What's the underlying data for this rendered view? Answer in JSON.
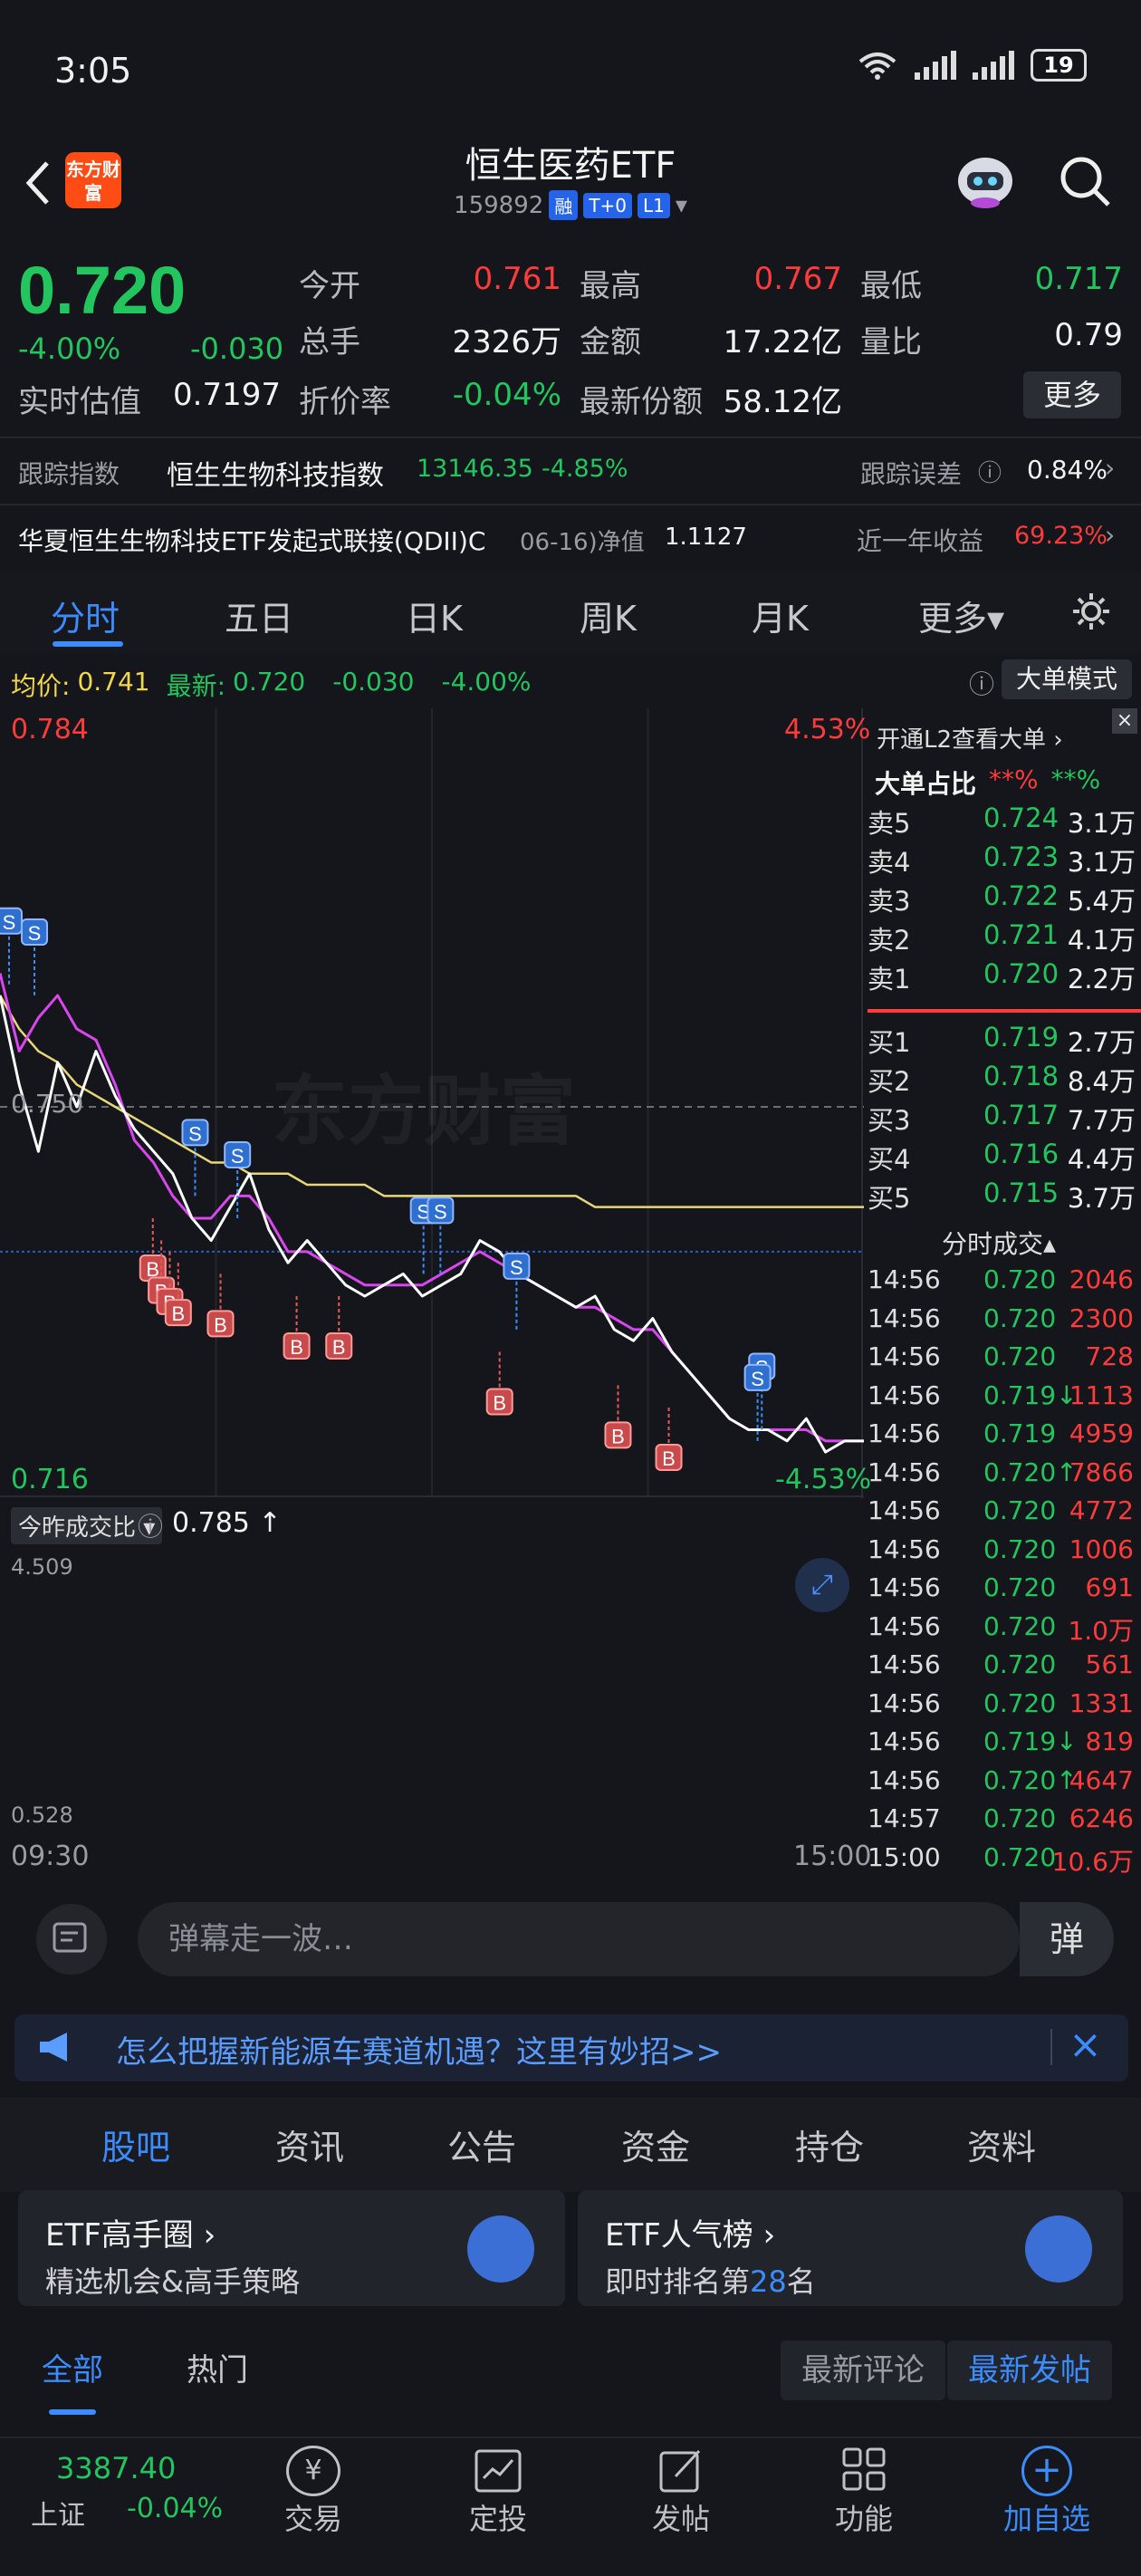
{
  "status_bar": {
    "time": "3:05",
    "battery": "19"
  },
  "header": {
    "logo_text": "东方财富",
    "title": "恒生医药ETF",
    "code": "159892",
    "tags": [
      "融",
      "T+0",
      "L1"
    ]
  },
  "quote": {
    "price": "0.720",
    "change_pct": "-4.00%",
    "change": "-0.030",
    "fields": [
      {
        "label": "今开",
        "value": "0.761",
        "color": "#ff3b3b"
      },
      {
        "label": "最高",
        "value": "0.767",
        "color": "#ff3b3b"
      },
      {
        "label": "最低",
        "value": "0.717",
        "color": "#22c55e"
      },
      {
        "label": "总手",
        "value": "2326万",
        "color": "#f2f2f2"
      },
      {
        "label": "金额",
        "value": "17.22亿",
        "color": "#f2f2f2"
      },
      {
        "label": "量比",
        "value": "0.79",
        "color": "#f2f2f2"
      },
      {
        "label": "实时估值",
        "value": "0.7197",
        "color": "#f2f2f2"
      },
      {
        "label": "折价率",
        "value": "-0.04%",
        "color": "#22c55e"
      },
      {
        "label": "最新份额",
        "value": "58.12亿",
        "color": "#f2f2f2"
      }
    ],
    "more_label": "更多"
  },
  "tracking": {
    "label": "跟踪指数",
    "index_name": "恒生生物科技指数",
    "index_value": "13146.35",
    "index_pct": "-4.85%",
    "error_label": "跟踪误差",
    "error_value": "0.84%"
  },
  "fund_link": {
    "name": "华夏恒生生物科技ETF发起式联接(QDII)C",
    "date_label": "06-16)净值",
    "nav": "1.1127",
    "yield_label": "近一年收益",
    "yield_value": "69.23%"
  },
  "tabs": [
    "分时",
    "五日",
    "日K",
    "周K",
    "月K",
    "更多▾"
  ],
  "chart_info": {
    "avg_label": "均价:",
    "avg_value": "0.741",
    "last_label": "最新:",
    "last_value": "0.720",
    "chg": "-0.030",
    "pct": "-4.00%",
    "mode_button": "大单模式"
  },
  "chart_data": {
    "type": "line",
    "title": "",
    "ylim": [
      0.716,
      0.784
    ],
    "y_max_label": "0.784",
    "y_mid_label": "0.750",
    "y_min_label": "0.716",
    "pct_max_label": "4.53%",
    "pct_min_label": "-4.53%",
    "x_start": "09:30",
    "x_end": "15:00",
    "watermark": "东方财富",
    "series": [
      {
        "values": [
          0.76,
          0.752,
          0.746,
          0.754,
          0.75,
          0.755,
          0.751,
          0.748,
          0.746,
          0.744,
          0.74,
          0.738,
          0.741,
          0.744,
          0.739,
          0.736,
          0.738,
          0.736,
          0.734,
          0.733,
          0.734,
          0.735,
          0.733,
          0.734,
          0.735,
          0.738,
          0.737,
          0.735,
          0.734,
          0.733,
          0.732,
          0.733,
          0.73,
          0.729,
          0.731,
          0.728,
          0.726,
          0.724,
          0.722,
          0.721,
          0.721,
          0.72,
          0.722,
          0.719,
          0.72,
          0.72
        ],
        "color": "#ffffff"
      },
      {
        "values": [
          0.762,
          0.755,
          0.758,
          0.76,
          0.757,
          0.756,
          0.752,
          0.747,
          0.745,
          0.742,
          0.74,
          0.74,
          0.742,
          0.742,
          0.74,
          0.737,
          0.737,
          0.736,
          0.735,
          0.734,
          0.734,
          0.734,
          0.734,
          0.735,
          0.736,
          0.737,
          0.736,
          0.735,
          0.734,
          0.733,
          0.732,
          0.732,
          0.731,
          0.73,
          0.73,
          0.728,
          0.726,
          0.724,
          0.722,
          0.721,
          0.721,
          0.721,
          0.721,
          0.72,
          0.72,
          0.72
        ],
        "color": "#d946ef"
      },
      {
        "values": [
          0.76,
          0.757,
          0.755,
          0.754,
          0.752,
          0.751,
          0.75,
          0.749,
          0.748,
          0.747,
          0.746,
          0.745,
          0.745,
          0.744,
          0.744,
          0.744,
          0.743,
          0.743,
          0.743,
          0.743,
          0.742,
          0.742,
          0.742,
          0.742,
          0.742,
          0.742,
          0.742,
          0.742,
          0.742,
          0.742,
          0.742,
          0.741,
          0.741,
          0.741,
          0.741,
          0.741,
          0.741,
          0.741,
          0.741,
          0.741,
          0.741,
          0.741,
          0.741,
          0.741,
          0.741,
          0.741
        ],
        "color": "#e8d77a"
      }
    ],
    "markers": [
      {
        "label": "S",
        "x": 0.0,
        "y": 0.761
      },
      {
        "label": "S",
        "x": 0.03,
        "y": 0.76
      },
      {
        "label": "S",
        "x": 0.22,
        "y": 0.742
      },
      {
        "label": "S",
        "x": 0.27,
        "y": 0.74
      },
      {
        "label": "S",
        "x": 0.49,
        "y": 0.735
      },
      {
        "label": "S",
        "x": 0.51,
        "y": 0.735
      },
      {
        "label": "S",
        "x": 0.6,
        "y": 0.73
      },
      {
        "label": "S",
        "x": 0.89,
        "y": 0.721
      },
      {
        "label": "S",
        "x": 0.885,
        "y": 0.72
      },
      {
        "label": "B",
        "x": 0.17,
        "y": 0.74
      },
      {
        "label": "B",
        "x": 0.18,
        "y": 0.738
      },
      {
        "label": "B",
        "x": 0.19,
        "y": 0.737
      },
      {
        "label": "B",
        "x": 0.2,
        "y": 0.736
      },
      {
        "label": "B",
        "x": 0.25,
        "y": 0.735
      },
      {
        "label": "B",
        "x": 0.34,
        "y": 0.733
      },
      {
        "label": "B",
        "x": 0.39,
        "y": 0.733
      },
      {
        "label": "B",
        "x": 0.58,
        "y": 0.728
      },
      {
        "label": "B",
        "x": 0.72,
        "y": 0.725
      },
      {
        "label": "B",
        "x": 0.78,
        "y": 0.723
      }
    ]
  },
  "volume_panel": {
    "selector": "今昨成交比",
    "ratio": "0.785",
    "top_label": "4.509",
    "bottom_label": "0.528"
  },
  "orderbook": {
    "open_l2": "开通L2查看大单",
    "big_ratio_label": "大单占比",
    "big_ratio_red": "**%",
    "big_ratio_green": "**%",
    "asks": [
      {
        "label": "卖5",
        "price": "0.724",
        "vol": "3.1万"
      },
      {
        "label": "卖4",
        "price": "0.723",
        "vol": "3.1万"
      },
      {
        "label": "卖3",
        "price": "0.722",
        "vol": "5.4万"
      },
      {
        "label": "卖2",
        "price": "0.721",
        "vol": "4.1万"
      },
      {
        "label": "卖1",
        "price": "0.720",
        "vol": "2.2万"
      }
    ],
    "bids": [
      {
        "label": "买1",
        "price": "0.719",
        "vol": "2.7万"
      },
      {
        "label": "买2",
        "price": "0.718",
        "vol": "8.4万"
      },
      {
        "label": "买3",
        "price": "0.717",
        "vol": "7.7万"
      },
      {
        "label": "买4",
        "price": "0.716",
        "vol": "4.4万"
      },
      {
        "label": "买5",
        "price": "0.715",
        "vol": "3.7万"
      }
    ],
    "trades_title": "分时成交▴",
    "trades": [
      {
        "t": "14:56",
        "p": "0.720",
        "v": "2046",
        "arrow": ""
      },
      {
        "t": "14:56",
        "p": "0.720",
        "v": "2300",
        "arrow": ""
      },
      {
        "t": "14:56",
        "p": "0.720",
        "v": "728",
        "arrow": ""
      },
      {
        "t": "14:56",
        "p": "0.719↓",
        "v": "1113",
        "arrow": "down"
      },
      {
        "t": "14:56",
        "p": "0.719",
        "v": "4959",
        "arrow": "down"
      },
      {
        "t": "14:56",
        "p": "0.720↑",
        "v": "7866",
        "arrow": "up"
      },
      {
        "t": "14:56",
        "p": "0.720",
        "v": "4772",
        "arrow": ""
      },
      {
        "t": "14:56",
        "p": "0.720",
        "v": "1006",
        "arrow": ""
      },
      {
        "t": "14:56",
        "p": "0.720",
        "v": "691",
        "arrow": ""
      },
      {
        "t": "14:56",
        "p": "0.720",
        "v": "1.0万",
        "arrow": ""
      },
      {
        "t": "14:56",
        "p": "0.720",
        "v": "561",
        "arrow": ""
      },
      {
        "t": "14:56",
        "p": "0.720",
        "v": "1331",
        "arrow": ""
      },
      {
        "t": "14:56",
        "p": "0.719↓",
        "v": "819",
        "arrow": "down"
      },
      {
        "t": "14:56",
        "p": "0.720↑",
        "v": "4647",
        "arrow": "up"
      },
      {
        "t": "14:57",
        "p": "0.720",
        "v": "6246",
        "arrow": ""
      },
      {
        "t": "15:00",
        "p": "0.720",
        "v": "10.6万",
        "arrow": ""
      }
    ]
  },
  "danmu": {
    "placeholder": "弹幕走一波…",
    "button": "弹"
  },
  "ad": {
    "text": "怎么把握新能源车赛道机遇？这里有妙招>>"
  },
  "subtabs": [
    "股吧",
    "资讯",
    "公告",
    "资金",
    "持仓",
    "资料"
  ],
  "cards": [
    {
      "title": "ETF高手圈",
      "sub": "精选机会&高手策略"
    },
    {
      "title": "ETF人气榜",
      "sub_pre": "即时排名第",
      "rank": "28",
      "sub_post": "名"
    }
  ],
  "filter": {
    "all": "全部",
    "hot": "热门",
    "latest_comment": "最新评论",
    "latest_post": "最新发帖"
  },
  "nav": {
    "index_value": "3387.40",
    "index_name": "上证",
    "index_pct": "-0.04%",
    "items": [
      "交易",
      "定投",
      "发帖",
      "功能",
      "加自选"
    ]
  }
}
